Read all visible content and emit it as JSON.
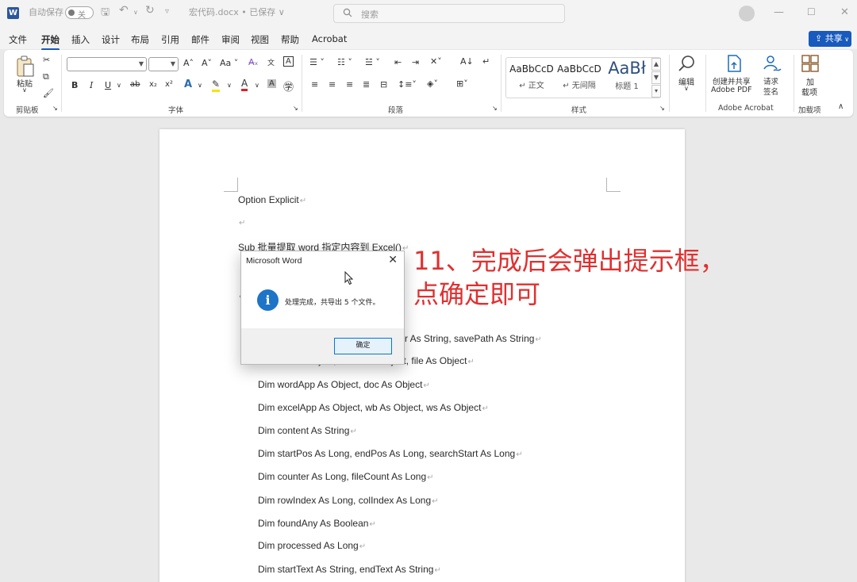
{
  "titlebar": {
    "autosave_label": "自动保存",
    "autosave_state": "关",
    "file_name": "宏代码.docx • 已保存 ∨",
    "search_placeholder": "搜索"
  },
  "menu": {
    "tabs": [
      "文件",
      "开始",
      "插入",
      "设计",
      "布局",
      "引用",
      "邮件",
      "审阅",
      "视图",
      "帮助",
      "Acrobat"
    ],
    "active_tab": "开始",
    "share_label": "共享"
  },
  "ribbon": {
    "clipboard": {
      "paste_label": "粘贴",
      "group_label": "剪贴板"
    },
    "font": {
      "group_label": "字体",
      "font_name": "",
      "font_size": ""
    },
    "paragraph": {
      "group_label": "段落"
    },
    "styles": {
      "group_label": "样式",
      "items": [
        {
          "sample": "AaBbCcD",
          "name": "↵ 正文"
        },
        {
          "sample": "AaBbCcD",
          "name": "↵ 无间隔"
        },
        {
          "sample": "AaBł",
          "name": "标题 1"
        }
      ]
    },
    "editing": {
      "label": "编辑"
    },
    "acrobat": {
      "create_pdf": "创建并共享",
      "create_pdf_2": "Adobe PDF",
      "sign": "请求",
      "sign_2": "签名",
      "group_label": "Adobe Acrobat"
    },
    "addins": {
      "label": "加",
      "label_2": "载项",
      "group_label": "加载项"
    }
  },
  "document": {
    "lines": [
      "Option Explicit",
      "",
      "Sub  批量提取 word 指定内容到 Excel()",
      "r As String, savePath As String",
      "Dim fso As Object, folder As Object, file As Object",
      "Dim wordApp As Object, doc As Object",
      "Dim excelApp As Object, wb As Object, ws As Object",
      "Dim content As String",
      "Dim startPos As Long, endPos As Long, searchStart As Long",
      "Dim counter As Long, fileCount As Long",
      "Dim rowIndex As Long, colIndex As Long",
      "Dim foundAny As Boolean",
      "Dim processed As Long",
      "Dim startText As String, endText As String"
    ]
  },
  "dialog": {
    "title": "Microsoft Word",
    "message": "处理完成，共导出 5 个文件。",
    "ok_label": "确定"
  },
  "annotation": {
    "line1": "11、完成后会弹出提示框，",
    "line2": "点确定即可"
  },
  "colors": {
    "accent": "#185abd",
    "annotation": "#e03030",
    "info_icon": "#1e74c6"
  }
}
